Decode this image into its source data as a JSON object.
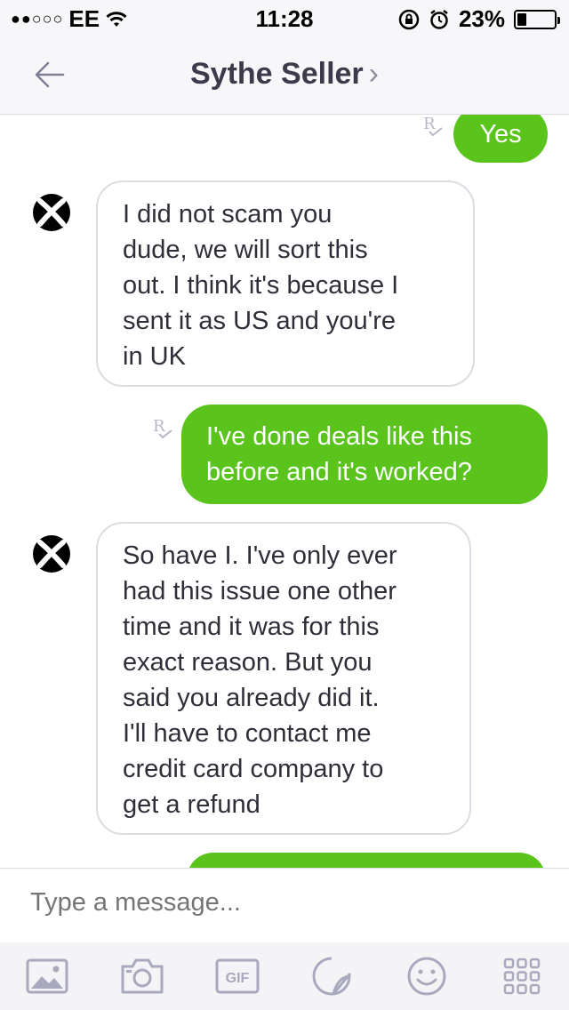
{
  "status_bar": {
    "carrier": "EE",
    "signal_dots": "●●○○○",
    "time": "11:28",
    "battery": "23%"
  },
  "header": {
    "title": "Sythe Seller",
    "chevron": "›"
  },
  "messages": [
    {
      "direction": "out",
      "text": "Yes",
      "read_receipt": "R"
    },
    {
      "direction": "in",
      "lines": [
        "I did not scam you",
        "dude, we will sort this",
        "out. I think it's because I",
        "sent it as US and you're",
        "in UK"
      ]
    },
    {
      "direction": "out",
      "lines": [
        "I've done deals like this",
        "before and it's worked?"
      ],
      "read_receipt": "R"
    },
    {
      "direction": "in",
      "lines": [
        "So have I. I've only ever",
        "had this issue one other",
        "time and it was for this",
        "exact reason. But you",
        "said you already did it.",
        "I'll have to contact me",
        "credit card company to",
        "get a refund"
      ]
    }
  ],
  "composer": {
    "placeholder": "Type a message..."
  },
  "toolbar": {
    "gif_label": "GIF"
  },
  "colors": {
    "accent_green": "#5ac41d",
    "header_bg": "#f7f7f9"
  }
}
